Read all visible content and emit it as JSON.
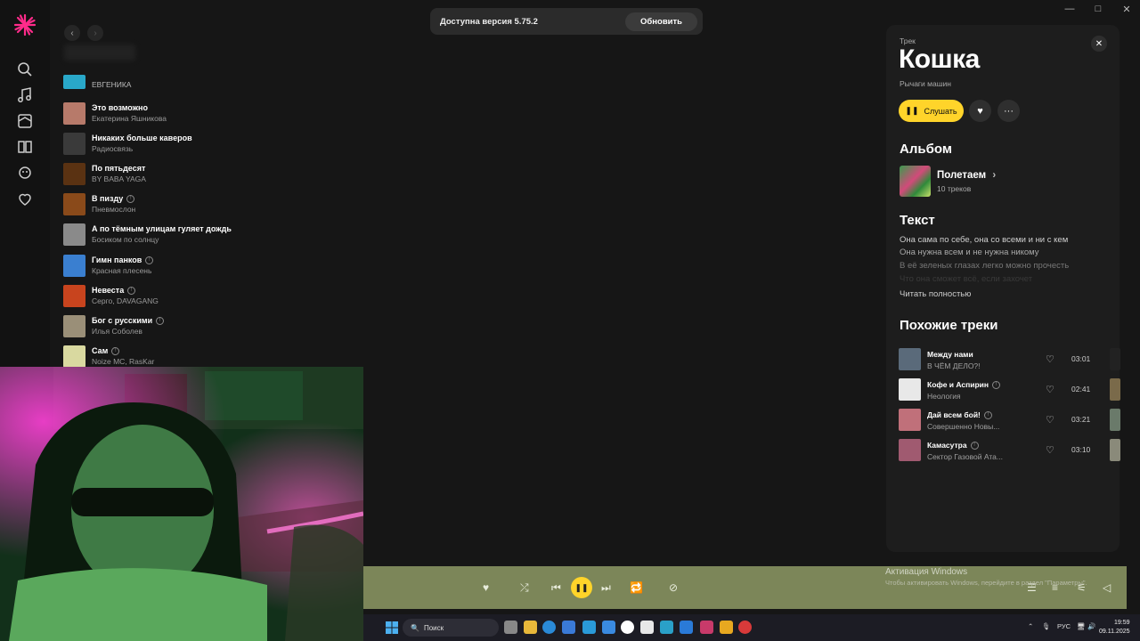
{
  "update_toast": {
    "text": "Доступна версия 5.75.2",
    "button": "Обновить"
  },
  "tracks": [
    {
      "title": "",
      "artist": "ЕВГЕНИКА",
      "explicit": false,
      "color": "#29a8c9"
    },
    {
      "title": "Это возможно",
      "artist": "Екатерина Яшникова",
      "explicit": false,
      "color": "#b77a6a"
    },
    {
      "title": "Никаких больше каверов",
      "artist": "Радиосвязь",
      "explicit": false,
      "color": "#3a3a3a"
    },
    {
      "title": "По пятьдесят",
      "artist": "BY BABA YAGA",
      "explicit": false,
      "color": "#5a3212"
    },
    {
      "title": "В пизду",
      "artist": "Пневмослон",
      "explicit": true,
      "color": "#8a4a1a"
    },
    {
      "title": "А по тёмным улицам гуляет дождь",
      "artist": "Босиком по солнцу",
      "explicit": false,
      "color": "#8a8a8a"
    },
    {
      "title": "Гимн панков",
      "artist": "Красная плесень",
      "explicit": true,
      "color": "#3a7fd0"
    },
    {
      "title": "Невеста",
      "artist": "Серго, DAVAGANG",
      "explicit": true,
      "color": "#c8441e"
    },
    {
      "title": "Бог с русскими",
      "artist": "Илья Соболев",
      "explicit": true,
      "color": "#9a8f78"
    },
    {
      "title": "Сам",
      "artist": "Noize MC, RasKar",
      "explicit": true,
      "color": "#d9d9a0"
    }
  ],
  "panel": {
    "kind": "Трек",
    "title": "Кошка",
    "artist": "Рычаги машин",
    "play_label": "Слушать",
    "album_heading": "Альбом",
    "album_name": "Полетаем",
    "album_count": "10 треков",
    "lyrics_heading": "Текст",
    "lyrics": [
      "Она сама по себе, она со всеми и ни с кем",
      "Она нужна всем и не нужна никому",
      "В её зеленых глазах легко можно прочесть",
      "Что она сможет всё, если захочет"
    ],
    "read_all": "Читать полностью",
    "similar_heading": "Похожие треки",
    "similar": [
      {
        "title": "Между нами",
        "artist": "В ЧЁМ ДЕЛО?!",
        "explicit": false,
        "duration": "03:01",
        "color": "#5a6a7a",
        "peek": "#222"
      },
      {
        "title": "Кофе и Аспирин",
        "artist": "Неология",
        "explicit": true,
        "duration": "02:41",
        "color": "#e8e8e8",
        "peek": "#7a6a4a"
      },
      {
        "title": "Дай всем бой!",
        "artist": "Совершенно Новы...",
        "explicit": true,
        "duration": "03:21",
        "color": "#c0707a",
        "peek": "#6a7a6a"
      },
      {
        "title": "Камасутра",
        "artist": "Сектор Газовой Ата...",
        "explicit": true,
        "duration": "03:10",
        "color": "#a05a70",
        "peek": "#8a8a7a"
      }
    ]
  },
  "activation": {
    "line1": "Активация Windows",
    "line2": "Чтобы активировать Windows, перейдите в раздел \"Параметры\"."
  },
  "taskbar": {
    "search": "Поиск",
    "lang": "РУС",
    "time": "19:59",
    "date": "09.11.2025"
  },
  "colors": {
    "accent": "#ffd42a",
    "player_bg": "#7c8659",
    "brand": "#ff2b8a"
  }
}
